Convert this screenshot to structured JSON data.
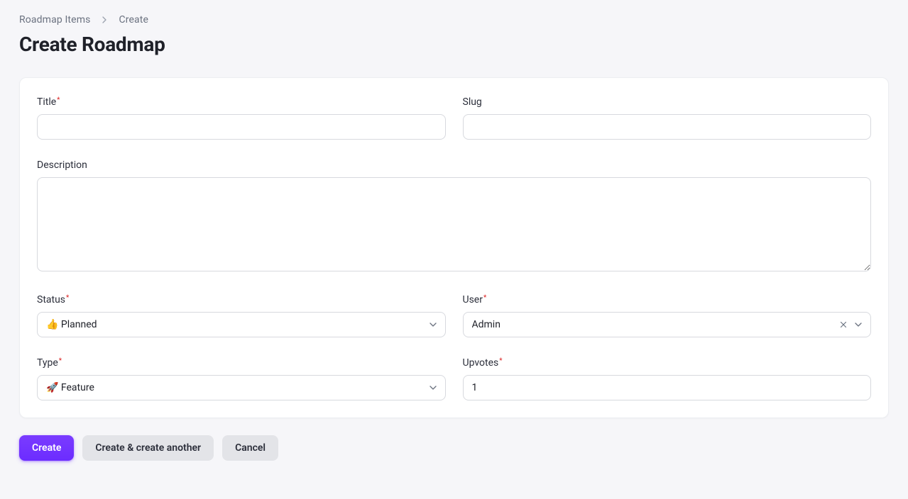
{
  "breadcrumb": {
    "root": "Roadmap Items",
    "current": "Create"
  },
  "page": {
    "title": "Create Roadmap"
  },
  "labels": {
    "title": "Title",
    "slug": "Slug",
    "description": "Description",
    "status": "Status",
    "user": "User",
    "type": "Type",
    "upvotes": "Upvotes"
  },
  "required_marker": "*",
  "fields": {
    "title": "",
    "slug": "",
    "description": "",
    "status": "👍 Planned",
    "user": "Admin",
    "type": "🚀 Feature",
    "upvotes": "1"
  },
  "actions": {
    "create": "Create",
    "create_another": "Create & create another",
    "cancel": "Cancel"
  }
}
